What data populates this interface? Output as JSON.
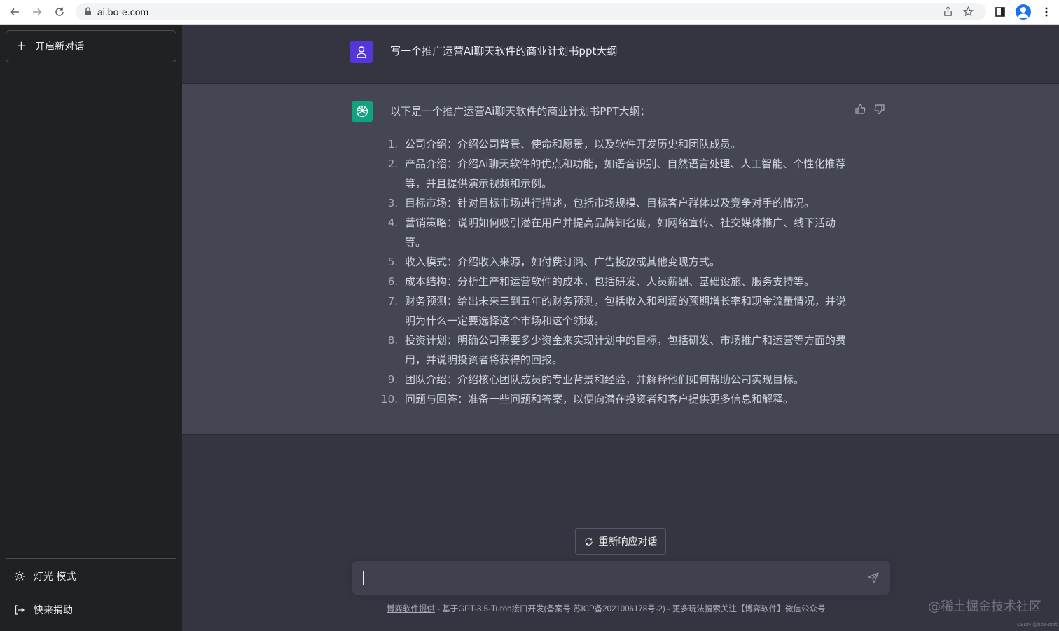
{
  "browser": {
    "url": "ai.bo-e.com"
  },
  "sidebar": {
    "new_chat_label": "开启新对话",
    "items": [
      {
        "label": "灯光 模式",
        "icon": "sun-icon"
      },
      {
        "label": "快来捐助",
        "icon": "logout-icon"
      }
    ]
  },
  "conversation": {
    "user_message": "写一个推广运营Ai聊天软件的商业计划书ppt大纲",
    "bot_intro": "以下是一个推广运营Ai聊天软件的商业计划书PPT大纲：",
    "outline": [
      {
        "num": "1.",
        "text": "公司介绍：介绍公司背景、使命和愿景，以及软件开发历史和团队成员。"
      },
      {
        "num": "2.",
        "text": "产品介绍：介绍Ai聊天软件的优点和功能，如语音识别、自然语言处理、人工智能、个性化推荐等，并且提供演示视频和示例。"
      },
      {
        "num": "3.",
        "text": "目标市场：针对目标市场进行描述，包括市场规模、目标客户群体以及竞争对手的情况。"
      },
      {
        "num": "4.",
        "text": "营销策略：说明如何吸引潜在用户并提高品牌知名度，如网络宣传、社交媒体推广、线下活动等。"
      },
      {
        "num": "5.",
        "text": "收入模式：介绍收入来源，如付费订阅、广告投放或其他变现方式。"
      },
      {
        "num": "6.",
        "text": "成本结构：分析生产和运营软件的成本，包括研发、人员薪酬、基础设施、服务支持等。"
      },
      {
        "num": "7.",
        "text": "财务预测：给出未来三到五年的财务预测，包括收入和利润的预期增长率和现金流量情况，并说明为什么一定要选择这个市场和这个领域。"
      },
      {
        "num": "8.",
        "text": "投资计划：明确公司需要多少资金来实现计划中的目标，包括研发、市场推广和运营等方面的费用，并说明投资者将获得的回报。"
      },
      {
        "num": "9.",
        "text": "团队介绍：介绍核心团队成员的专业背景和经验，并解释他们如何帮助公司实现目标。"
      },
      {
        "num": "10.",
        "text": "问题与回答：准备一些问题和答案，以便向潜在投资者和客户提供更多信息和解释。"
      }
    ]
  },
  "composer": {
    "regenerate_label": "重新响应对话",
    "input_value": "",
    "footer_link": "博弈软件提供",
    "footer_rest": " - 基于GPT-3.5-Turob接口开发(备案号:苏ICP备2021006178号-2) - 更多玩法搜索关注【博弈软件】微信公众号"
  },
  "watermark": {
    "main": "@稀土掘金技术社区",
    "small": "CSDN @boe-soft"
  },
  "colors": {
    "sidebar_bg": "#202123",
    "main_bg": "#343541",
    "bot_bg": "#444654",
    "user_avatar": "#5436da",
    "bot_avatar": "#10a37f"
  }
}
